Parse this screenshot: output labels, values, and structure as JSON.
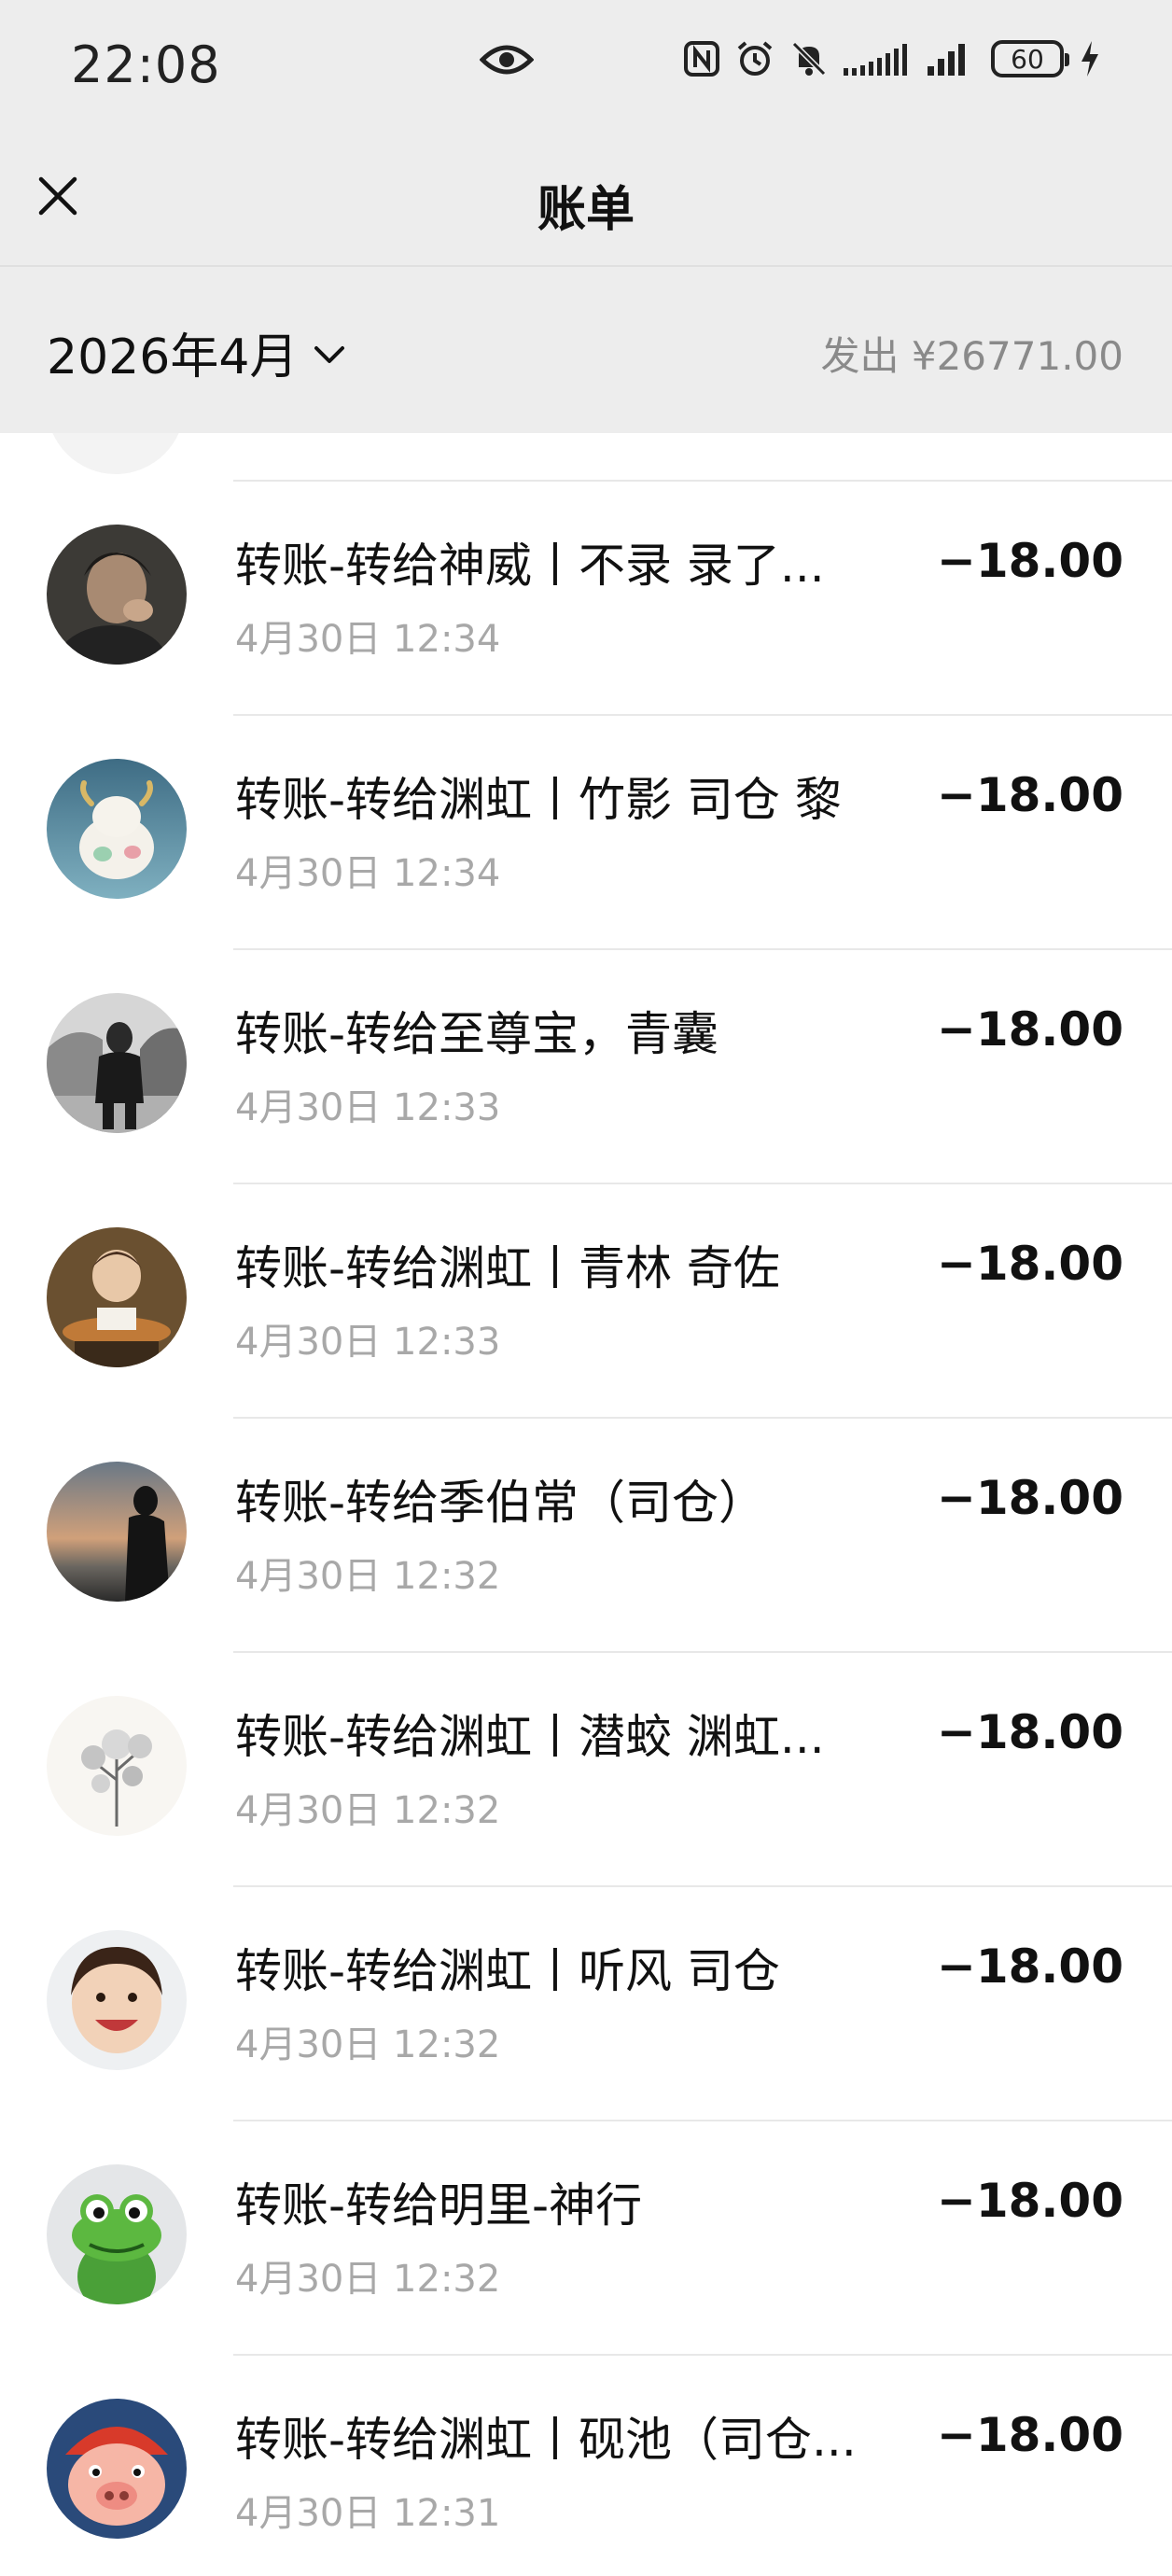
{
  "status_bar": {
    "time": "22:08",
    "battery": "60",
    "icons": [
      "eye-icon",
      "nfc-icon",
      "alarm-icon",
      "mute-icon",
      "signal-icon",
      "signal-icon",
      "battery-icon",
      "charging-icon"
    ]
  },
  "header": {
    "title": "账单",
    "close_icon": "close-icon"
  },
  "filter": {
    "month": "2026年4月",
    "summary": "发出 ¥26771.00"
  },
  "transactions": [
    {
      "title": "转账-转给神威丨不录 录了...",
      "time": "4月30日 12:34",
      "amount": "−18.00",
      "avatar": "dark-portrait"
    },
    {
      "title": "转账-转给渊虹丨竹影 司仓 黎",
      "time": "4月30日 12:34",
      "amount": "−18.00",
      "avatar": "ox-figurine"
    },
    {
      "title": "转账-转给至尊宝，青囊",
      "time": "4月30日 12:33",
      "amount": "−18.00",
      "avatar": "bw-man"
    },
    {
      "title": "转账-转给渊虹丨青林 奇佐",
      "time": "4月30日 12:33",
      "amount": "−18.00",
      "avatar": "child-cake"
    },
    {
      "title": "转账-转给季伯常（司仓）",
      "time": "4月30日 12:32",
      "amount": "−18.00",
      "avatar": "sunset-silhouette"
    },
    {
      "title": "转账-转给渊虹丨潜蛟 渊虹...",
      "time": "4月30日 12:32",
      "amount": "−18.00",
      "avatar": "ink-flowers"
    },
    {
      "title": "转账-转给渊虹丨听风 司仓",
      "time": "4月30日 12:32",
      "amount": "−18.00",
      "avatar": "smiling-child"
    },
    {
      "title": "转账-转给明里-神行",
      "time": "4月30日 12:32",
      "amount": "−18.00",
      "avatar": "green-frog"
    },
    {
      "title": "转账-转给渊虹丨砚池（司仓...",
      "time": "4月30日 12:31",
      "amount": "−18.00",
      "avatar": "pig-cartoon"
    }
  ]
}
